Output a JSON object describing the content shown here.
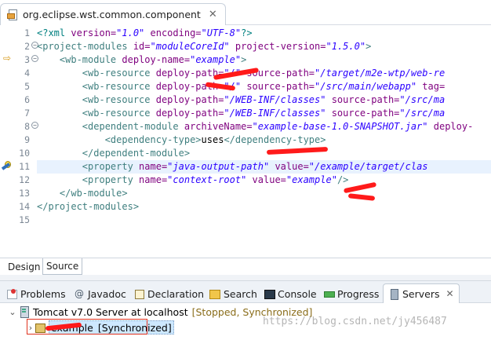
{
  "editor": {
    "tab_title": "org.eclipse.wst.common.component",
    "lines": [
      {
        "no": "1",
        "segments": [
          {
            "t": "pi",
            "s": "<?xml "
          },
          {
            "t": "attr",
            "s": "version="
          },
          {
            "t": "val",
            "s": "\"1.0\""
          },
          {
            "t": "attr",
            "s": " encoding="
          },
          {
            "t": "val",
            "s": "\"UTF-8\""
          },
          {
            "t": "pi",
            "s": "?>"
          }
        ]
      },
      {
        "no": "2",
        "segments": [
          {
            "t": "tag",
            "s": "<project-modules "
          },
          {
            "t": "attr",
            "s": "id="
          },
          {
            "t": "val",
            "s": "\"moduleCoreId\""
          },
          {
            "t": "attr",
            "s": " project-version="
          },
          {
            "t": "val",
            "s": "\"1.5.0\""
          },
          {
            "t": "tag",
            "s": ">"
          }
        ]
      },
      {
        "no": "3",
        "segments": [
          {
            "t": "text",
            "s": "    "
          },
          {
            "t": "tag",
            "s": "<wb-module "
          },
          {
            "t": "attr",
            "s": "deploy-name="
          },
          {
            "t": "val",
            "s": "\"example\""
          },
          {
            "t": "tag",
            "s": ">"
          }
        ]
      },
      {
        "no": "4",
        "segments": [
          {
            "t": "text",
            "s": "        "
          },
          {
            "t": "tag",
            "s": "<wb-resource "
          },
          {
            "t": "attr",
            "s": "deploy-path="
          },
          {
            "t": "val",
            "s": "\"/\""
          },
          {
            "t": "attr",
            "s": " source-path="
          },
          {
            "t": "val",
            "s": "\"/target/m2e-wtp/web-re"
          }
        ]
      },
      {
        "no": "5",
        "segments": [
          {
            "t": "text",
            "s": "        "
          },
          {
            "t": "tag",
            "s": "<wb-resource "
          },
          {
            "t": "attr",
            "s": "deploy-path="
          },
          {
            "t": "val",
            "s": "\"/\""
          },
          {
            "t": "attr",
            "s": " source-path="
          },
          {
            "t": "val",
            "s": "\"/src/main/webapp\""
          },
          {
            "t": "attr",
            "s": " tag="
          }
        ]
      },
      {
        "no": "6",
        "segments": [
          {
            "t": "text",
            "s": "        "
          },
          {
            "t": "tag",
            "s": "<wb-resource "
          },
          {
            "t": "attr",
            "s": "deploy-path="
          },
          {
            "t": "val",
            "s": "\"/WEB-INF/classes\""
          },
          {
            "t": "attr",
            "s": " source-path="
          },
          {
            "t": "val",
            "s": "\"/src/ma"
          }
        ]
      },
      {
        "no": "7",
        "segments": [
          {
            "t": "text",
            "s": "        "
          },
          {
            "t": "tag",
            "s": "<wb-resource "
          },
          {
            "t": "attr",
            "s": "deploy-path="
          },
          {
            "t": "val",
            "s": "\"/WEB-INF/classes\""
          },
          {
            "t": "attr",
            "s": " source-path="
          },
          {
            "t": "val",
            "s": "\"/src/ma"
          }
        ]
      },
      {
        "no": "8",
        "segments": [
          {
            "t": "text",
            "s": "        "
          },
          {
            "t": "tag",
            "s": "<dependent-module "
          },
          {
            "t": "attr",
            "s": "archiveName="
          },
          {
            "t": "val",
            "s": "\"example-base-1.0-SNAPSHOT.jar\""
          },
          {
            "t": "attr",
            "s": " deploy-"
          }
        ]
      },
      {
        "no": "9",
        "segments": [
          {
            "t": "text",
            "s": "            "
          },
          {
            "t": "tag",
            "s": "<dependency-type>"
          },
          {
            "t": "text",
            "s": "uses"
          },
          {
            "t": "tag",
            "s": "</dependency-type>"
          }
        ]
      },
      {
        "no": "10",
        "segments": [
          {
            "t": "text",
            "s": "        "
          },
          {
            "t": "tag",
            "s": "</dependent-module>"
          }
        ]
      },
      {
        "no": "11",
        "segments": [
          {
            "t": "text",
            "s": "        "
          },
          {
            "t": "tag",
            "s": "<property "
          },
          {
            "t": "attr",
            "s": "name="
          },
          {
            "t": "val",
            "s": "\"java-output-path\""
          },
          {
            "t": "attr",
            "s": " value="
          },
          {
            "t": "val",
            "s": "\"/example/target/clas"
          }
        ]
      },
      {
        "no": "12",
        "segments": [
          {
            "t": "text",
            "s": "        "
          },
          {
            "t": "tag",
            "s": "<property "
          },
          {
            "t": "attr",
            "s": "name="
          },
          {
            "t": "val",
            "s": "\"context-root\""
          },
          {
            "t": "attr",
            "s": " value="
          },
          {
            "t": "val",
            "s": "\"example\""
          },
          {
            "t": "tag",
            "s": "/>"
          }
        ]
      },
      {
        "no": "13",
        "segments": [
          {
            "t": "text",
            "s": "    "
          },
          {
            "t": "tag",
            "s": "</wb-module>"
          }
        ]
      },
      {
        "no": "14",
        "segments": [
          {
            "t": "tag",
            "s": "</project-modules>"
          }
        ]
      },
      {
        "no": "15",
        "segments": []
      }
    ],
    "current_line": "11"
  },
  "mode_tabs": {
    "design": "Design",
    "source": "Source"
  },
  "views": {
    "problems": "Problems",
    "javadoc": "Javadoc",
    "javadoc_glyph": "@",
    "declaration": "Declaration",
    "search": "Search",
    "console": "Console",
    "progress": "Progress",
    "servers": "Servers"
  },
  "servers": {
    "server_name": "Tomcat v7.0 Server at localhost",
    "server_state": "[Stopped, Synchronized]",
    "module_name": "example",
    "module_state": "[Synchronized]"
  },
  "watermark": "https://blog.csdn.net/jy456487",
  "colors": {
    "tag": "#3f7f7f",
    "attr": "#7f007f",
    "value": "#2a00ff",
    "redaction": "#ff1a1a"
  }
}
